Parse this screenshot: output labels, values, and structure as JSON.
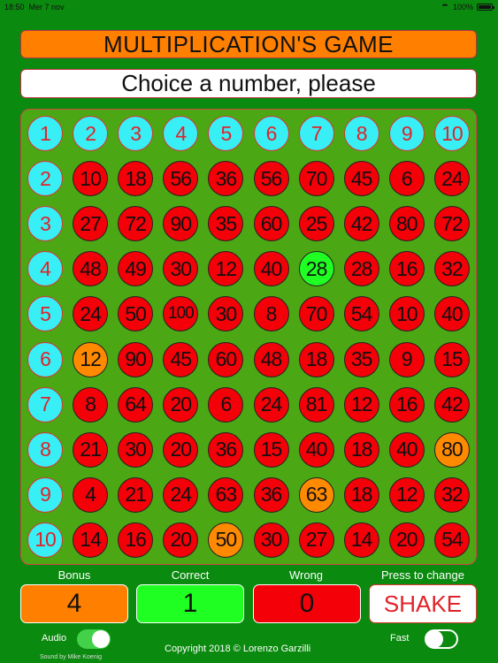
{
  "status": {
    "time": "18:50",
    "date": "Mer 7 nov",
    "battery": "100%"
  },
  "title": "MULTIPLICATION'S GAME",
  "prompt": "Choice a number, please",
  "grid": {
    "header_row": [
      "1",
      "2",
      "3",
      "4",
      "5",
      "6",
      "7",
      "8",
      "9",
      "10"
    ],
    "rows": [
      {
        "header": "2",
        "cells": [
          {
            "v": "10",
            "s": "red"
          },
          {
            "v": "18",
            "s": "red"
          },
          {
            "v": "56",
            "s": "red"
          },
          {
            "v": "36",
            "s": "red"
          },
          {
            "v": "56",
            "s": "red"
          },
          {
            "v": "70",
            "s": "red"
          },
          {
            "v": "45",
            "s": "red"
          },
          {
            "v": "6",
            "s": "red"
          },
          {
            "v": "24",
            "s": "red"
          }
        ]
      },
      {
        "header": "3",
        "cells": [
          {
            "v": "27",
            "s": "red"
          },
          {
            "v": "72",
            "s": "red"
          },
          {
            "v": "90",
            "s": "red"
          },
          {
            "v": "35",
            "s": "red"
          },
          {
            "v": "60",
            "s": "red"
          },
          {
            "v": "25",
            "s": "red"
          },
          {
            "v": "42",
            "s": "red"
          },
          {
            "v": "80",
            "s": "red"
          },
          {
            "v": "72",
            "s": "red"
          }
        ]
      },
      {
        "header": "4",
        "cells": [
          {
            "v": "48",
            "s": "red"
          },
          {
            "v": "49",
            "s": "red"
          },
          {
            "v": "30",
            "s": "red"
          },
          {
            "v": "12",
            "s": "red"
          },
          {
            "v": "40",
            "s": "red"
          },
          {
            "v": "28",
            "s": "green"
          },
          {
            "v": "28",
            "s": "red"
          },
          {
            "v": "16",
            "s": "red"
          },
          {
            "v": "32",
            "s": "red"
          }
        ]
      },
      {
        "header": "5",
        "cells": [
          {
            "v": "24",
            "s": "red"
          },
          {
            "v": "50",
            "s": "red"
          },
          {
            "v": "100",
            "s": "red"
          },
          {
            "v": "30",
            "s": "red"
          },
          {
            "v": "8",
            "s": "red"
          },
          {
            "v": "70",
            "s": "red"
          },
          {
            "v": "54",
            "s": "red"
          },
          {
            "v": "10",
            "s": "red"
          },
          {
            "v": "40",
            "s": "red"
          }
        ]
      },
      {
        "header": "6",
        "cells": [
          {
            "v": "12",
            "s": "orange"
          },
          {
            "v": "90",
            "s": "red"
          },
          {
            "v": "45",
            "s": "red"
          },
          {
            "v": "60",
            "s": "red"
          },
          {
            "v": "48",
            "s": "red"
          },
          {
            "v": "18",
            "s": "red"
          },
          {
            "v": "35",
            "s": "red"
          },
          {
            "v": "9",
            "s": "red"
          },
          {
            "v": "15",
            "s": "red"
          }
        ]
      },
      {
        "header": "7",
        "cells": [
          {
            "v": "8",
            "s": "red"
          },
          {
            "v": "64",
            "s": "red"
          },
          {
            "v": "20",
            "s": "red"
          },
          {
            "v": "6",
            "s": "red"
          },
          {
            "v": "24",
            "s": "red"
          },
          {
            "v": "81",
            "s": "red"
          },
          {
            "v": "12",
            "s": "red"
          },
          {
            "v": "16",
            "s": "red"
          },
          {
            "v": "42",
            "s": "red"
          }
        ]
      },
      {
        "header": "8",
        "cells": [
          {
            "v": "21",
            "s": "red"
          },
          {
            "v": "30",
            "s": "red"
          },
          {
            "v": "20",
            "s": "red"
          },
          {
            "v": "36",
            "s": "red"
          },
          {
            "v": "15",
            "s": "red"
          },
          {
            "v": "40",
            "s": "red"
          },
          {
            "v": "18",
            "s": "red"
          },
          {
            "v": "40",
            "s": "red"
          },
          {
            "v": "80",
            "s": "orange"
          }
        ]
      },
      {
        "header": "9",
        "cells": [
          {
            "v": "4",
            "s": "red"
          },
          {
            "v": "21",
            "s": "red"
          },
          {
            "v": "24",
            "s": "red"
          },
          {
            "v": "63",
            "s": "red"
          },
          {
            "v": "36",
            "s": "red"
          },
          {
            "v": "63",
            "s": "orange"
          },
          {
            "v": "18",
            "s": "red"
          },
          {
            "v": "12",
            "s": "red"
          },
          {
            "v": "32",
            "s": "red"
          }
        ]
      },
      {
        "header": "10",
        "cells": [
          {
            "v": "14",
            "s": "red"
          },
          {
            "v": "16",
            "s": "red"
          },
          {
            "v": "20",
            "s": "red"
          },
          {
            "v": "50",
            "s": "orange"
          },
          {
            "v": "30",
            "s": "red"
          },
          {
            "v": "27",
            "s": "red"
          },
          {
            "v": "14",
            "s": "red"
          },
          {
            "v": "20",
            "s": "red"
          },
          {
            "v": "54",
            "s": "red"
          }
        ]
      }
    ]
  },
  "scores": {
    "bonus_label": "Bonus",
    "bonus": "4",
    "correct_label": "Correct",
    "correct": "1",
    "wrong_label": "Wrong",
    "wrong": "0",
    "shake_hint": "Press to change",
    "shake": "SHAKE"
  },
  "settings": {
    "audio_label": "Audio",
    "audio_on": true,
    "fast_label": "Fast",
    "fast_on": false,
    "sound_credit": "Sound by Mike Koenig"
  },
  "copyright": "Copyright 2018 © Lorenzo Garzilli",
  "colors": {
    "background": "#0a8a0e",
    "board": "#4ca714",
    "header_cell": "#38eff6",
    "red_cell": "#f40008",
    "green_cell": "#1fff22",
    "orange_cell": "#ff8a00",
    "bonus_box": "#ff8000",
    "correct_box": "#1fff22",
    "wrong_box": "#f40008"
  }
}
